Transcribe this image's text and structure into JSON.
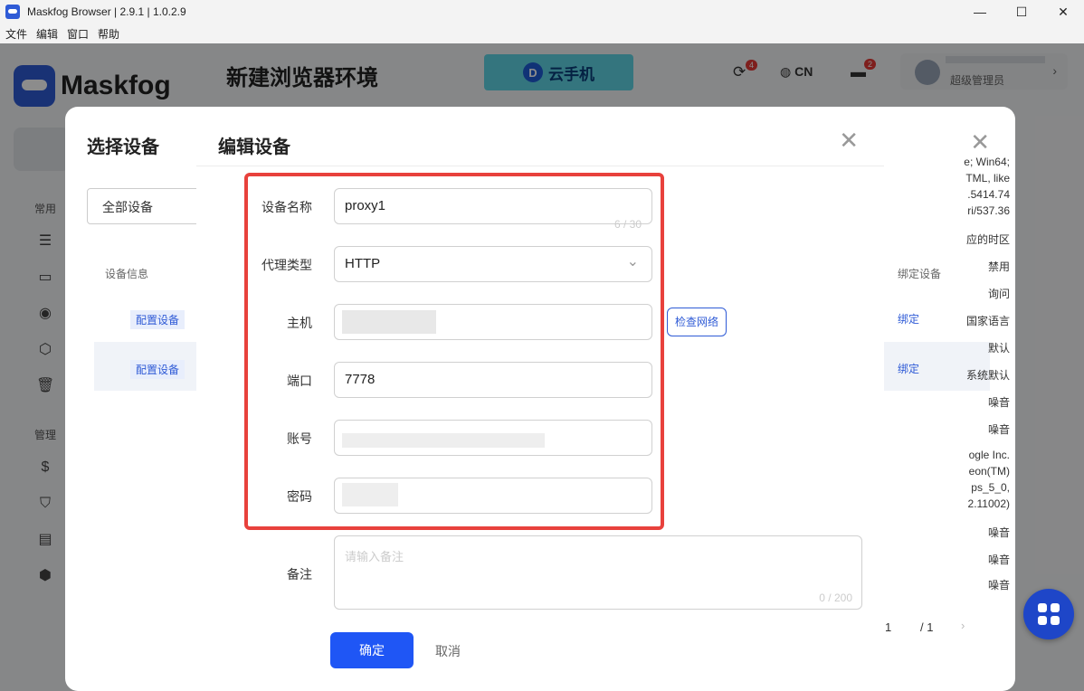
{
  "titlebar": {
    "title": "Maskfog Browser | 2.9.1 | 1.0.2.9",
    "minimize": "—",
    "maximize": "☐",
    "close": "✕"
  },
  "menu": [
    "文件",
    "编辑",
    "窗口",
    "帮助"
  ],
  "app": {
    "brand": "Maskfog",
    "page_title": "新建浏览器环境",
    "banner": {
      "icon_text": "D",
      "label": "云手机"
    },
    "sync_badge": "4",
    "lang": "CN",
    "msg_badge": "2",
    "user_role": "超级管理员",
    "sidebar_sections": [
      "常用",
      "管理"
    ]
  },
  "back_dialog": {
    "title": "选择设备",
    "filter_value": "全部设备",
    "col_device_info": "设备信息",
    "col_bind_device": "绑定设备",
    "rows": [
      {
        "tag": "配置设备",
        "bind": "绑定"
      },
      {
        "tag": "配置设备",
        "bind": "绑定"
      }
    ],
    "right_texts": [
      "e; Win64;",
      "TML, like",
      ".5414.74",
      "ri/537.36",
      "应的时区",
      "禁用",
      "询问",
      "国家语言",
      "默认",
      "系统默认",
      "噪音",
      "噪音",
      "ogle Inc.",
      "eon(TM)",
      "ps_5_0,",
      "2.11002)",
      "噪音",
      "噪音",
      "噪音"
    ],
    "pager": {
      "current": "1",
      "total": "/ 1",
      "next": "›"
    }
  },
  "dialog": {
    "title": "编辑设备",
    "close": "✕",
    "fields": {
      "device_name": {
        "label": "设备名称",
        "value": "proxy1",
        "counter": "6 / 30"
      },
      "proxy_type": {
        "label": "代理类型",
        "value": "HTTP"
      },
      "host": {
        "label": "主机",
        "value": ""
      },
      "port": {
        "label": "端口",
        "value": "7778"
      },
      "account": {
        "label": "账号",
        "value": ""
      },
      "password": {
        "label": "密码",
        "value": ""
      },
      "remark": {
        "label": "备注",
        "placeholder": "请输入备注",
        "counter": "0 / 200"
      }
    },
    "check_network": "检查网络",
    "confirm": "确定",
    "cancel": "取消"
  }
}
